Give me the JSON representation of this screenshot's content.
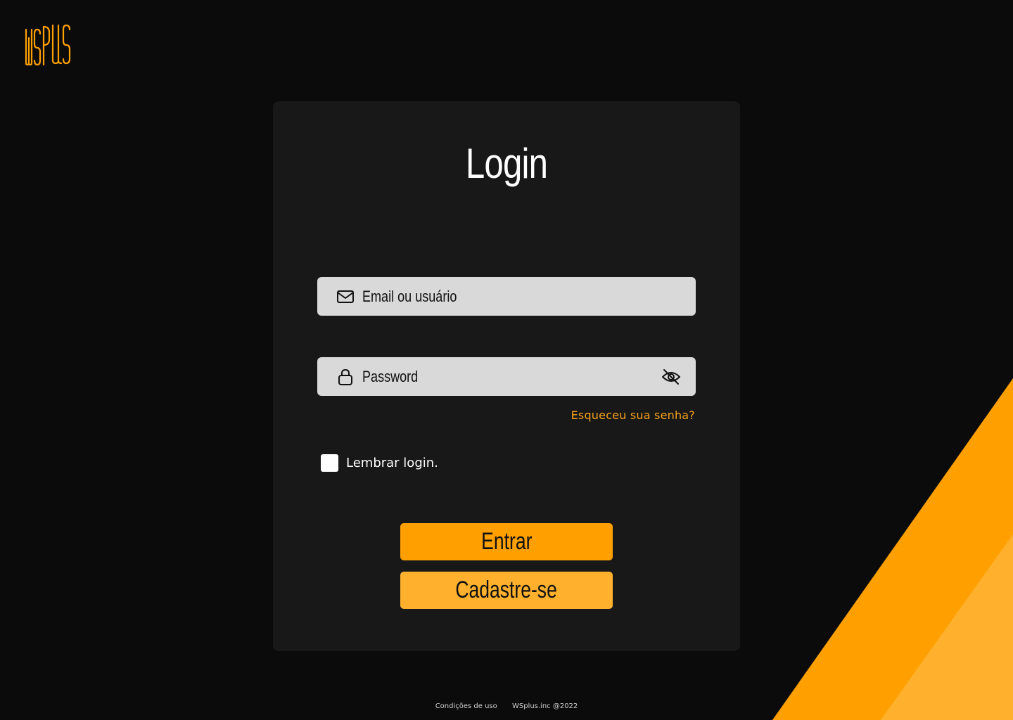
{
  "brand": {
    "logo_text": "WSPLUS",
    "accent_color": "#ffa000",
    "accent_light": "#ffb12e",
    "background": "#0b0b0b",
    "card_background": "#181818"
  },
  "login": {
    "title": "Login",
    "email": {
      "placeholder": "Email ou usuário",
      "value": "",
      "icon": "mail-icon"
    },
    "password": {
      "placeholder": "Password",
      "value": "",
      "icon": "lock-icon",
      "toggle_icon": "eye-off-icon"
    },
    "forgot_link": "Esqueceu sua senha?",
    "remember_label": "Lembrar login.",
    "remember_checked": false,
    "submit_label": "Entrar",
    "signup_label": "Cadastre-se"
  },
  "footer": {
    "terms": "Condições de uso",
    "copyright": "WSplus.inc @2022"
  }
}
